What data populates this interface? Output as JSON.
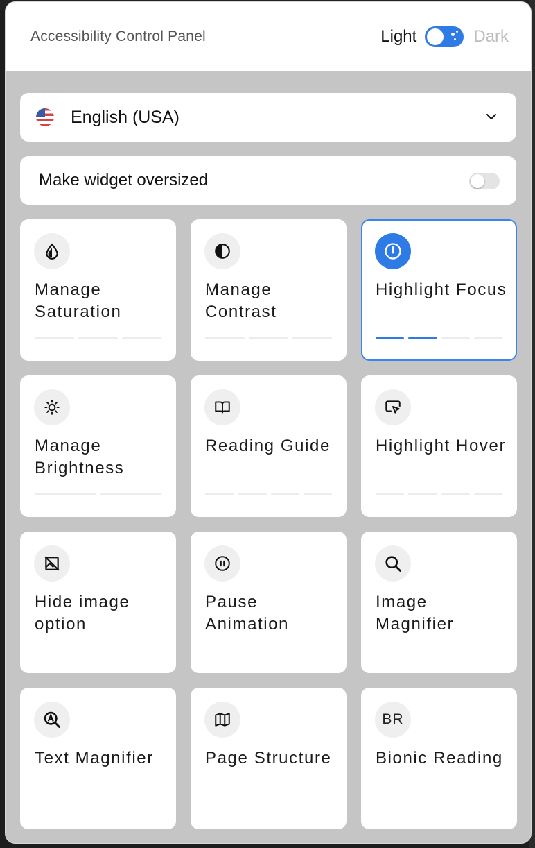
{
  "header": {
    "title": "Accessibility Control Panel",
    "theme_light_label": "Light",
    "theme_dark_label": "Dark",
    "theme_toggle_on": true
  },
  "language": {
    "selected": "English (USA)",
    "flag_icon": "us-flag-icon"
  },
  "oversize": {
    "label": "Make widget oversized",
    "enabled": false
  },
  "accent_color": "#2f7be5",
  "tiles": [
    {
      "label": "Manage Saturation",
      "icon": "droplet-icon",
      "levels": 3,
      "level": 0,
      "active": false
    },
    {
      "label": "Manage Contrast",
      "icon": "contrast-icon",
      "levels": 3,
      "level": 0,
      "active": false
    },
    {
      "label": "Highlight Focus",
      "icon": "focus-icon",
      "levels": 4,
      "level": 2,
      "active": true
    },
    {
      "label": "Manage Brightness",
      "icon": "sun-icon",
      "levels": 2,
      "level": 0,
      "active": false
    },
    {
      "label": "Reading Guide",
      "icon": "book-icon",
      "levels": 4,
      "level": 0,
      "active": false
    },
    {
      "label": "Highlight Hover",
      "icon": "hover-pointer-icon",
      "levels": 4,
      "level": 0,
      "active": false
    },
    {
      "label": "Hide image option",
      "icon": "hide-image-icon",
      "levels": 0,
      "level": 0,
      "active": false
    },
    {
      "label": "Pause Animation",
      "icon": "pause-icon",
      "levels": 0,
      "level": 0,
      "active": false
    },
    {
      "label": "Image Magnifier",
      "icon": "magnifier-icon",
      "levels": 0,
      "level": 0,
      "active": false
    },
    {
      "label": "Text Magnifier",
      "icon": "text-magnifier-icon",
      "levels": 0,
      "level": 0,
      "active": false
    },
    {
      "label": "Page Structure",
      "icon": "map-icon",
      "levels": 0,
      "level": 0,
      "active": false
    },
    {
      "label": "Bionic Reading",
      "icon": "br-icon",
      "icon_text": "BR",
      "levels": 0,
      "level": 0,
      "active": false
    }
  ]
}
